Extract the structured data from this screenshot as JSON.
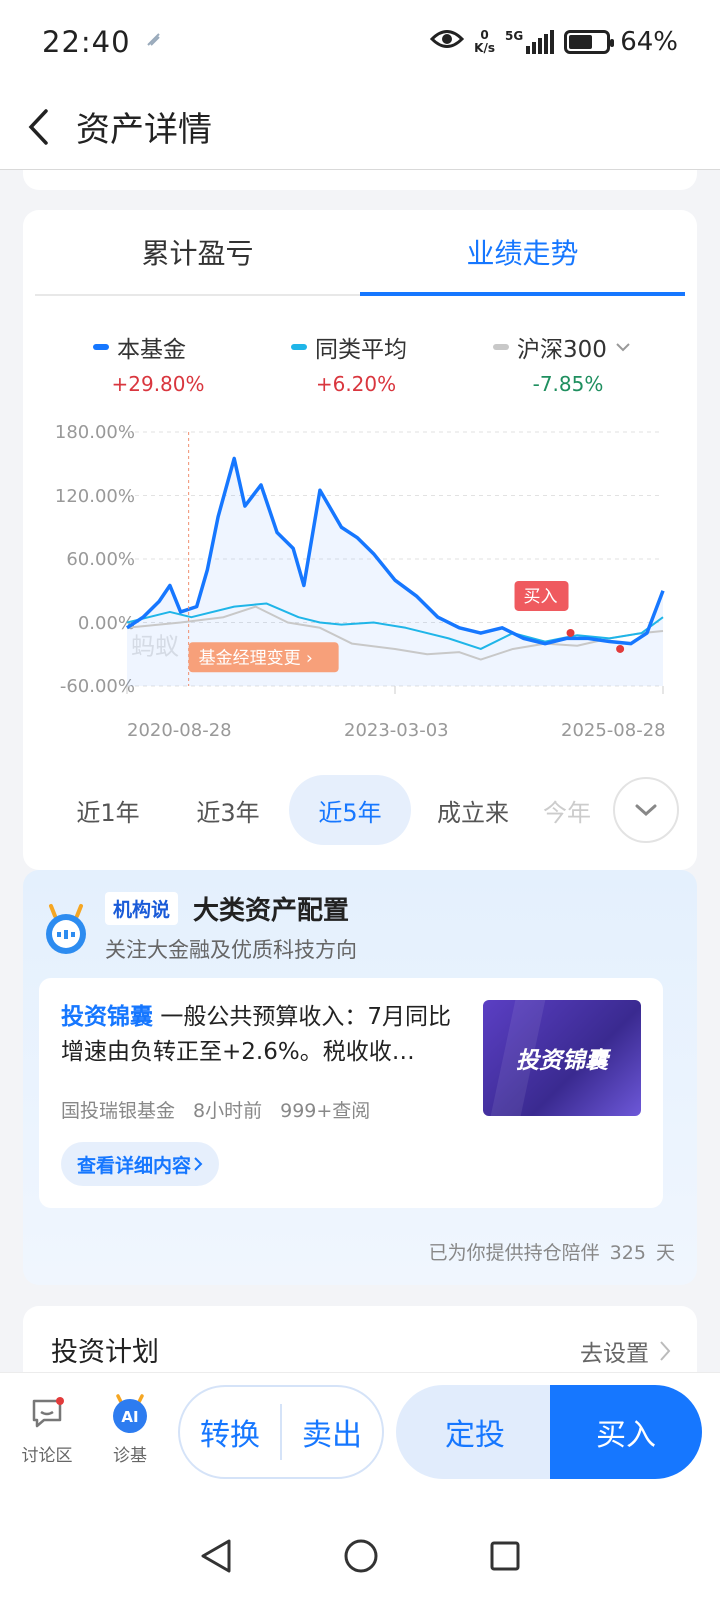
{
  "status": {
    "time": "22:40",
    "net_speed_value": "0",
    "net_speed_unit": "K/s",
    "network": "5G",
    "battery": "64%",
    "battery_level": 0.64
  },
  "header": {
    "title": "资产详情"
  },
  "perf_tabs": [
    {
      "label": "累计盈亏",
      "active": false
    },
    {
      "label": "业绩走势",
      "active": true
    }
  ],
  "legend": [
    {
      "name": "本基金",
      "value": "+29.80%",
      "color": "#1677ff"
    },
    {
      "name": "同类平均",
      "value": "+6.20%",
      "color": "#1fb5e8"
    },
    {
      "name": "沪深300",
      "value": "-7.85%",
      "color": "#c8c8c8"
    }
  ],
  "chart": {
    "watermark": "蚂蚁",
    "manager_change_label": "基金经理变更",
    "buy_marker_label": "买入"
  },
  "chart_data": {
    "type": "line",
    "ylim": [
      -60,
      180
    ],
    "y_ticks": [
      "180.00%",
      "120.00%",
      "60.00%",
      "0.00%",
      "-60.00%"
    ],
    "x_ticks": [
      "2020-08-28",
      "2023-03-03",
      "2025-08-28"
    ],
    "series": [
      {
        "name": "本基金",
        "color": "#1677ff",
        "points": [
          [
            0,
            -5
          ],
          [
            0.03,
            5
          ],
          [
            0.06,
            20
          ],
          [
            0.08,
            35
          ],
          [
            0.1,
            10
          ],
          [
            0.13,
            15
          ],
          [
            0.15,
            50
          ],
          [
            0.17,
            100
          ],
          [
            0.2,
            155
          ],
          [
            0.22,
            110
          ],
          [
            0.25,
            130
          ],
          [
            0.28,
            85
          ],
          [
            0.31,
            70
          ],
          [
            0.33,
            35
          ],
          [
            0.36,
            125
          ],
          [
            0.4,
            90
          ],
          [
            0.43,
            80
          ],
          [
            0.46,
            65
          ],
          [
            0.5,
            40
          ],
          [
            0.54,
            25
          ],
          [
            0.58,
            5
          ],
          [
            0.62,
            -5
          ],
          [
            0.66,
            -10
          ],
          [
            0.7,
            -5
          ],
          [
            0.74,
            -15
          ],
          [
            0.78,
            -20
          ],
          [
            0.82,
            -15
          ],
          [
            0.86,
            -15
          ],
          [
            0.9,
            -18
          ],
          [
            0.94,
            -20
          ],
          [
            0.97,
            -10
          ],
          [
            1.0,
            30
          ]
        ]
      },
      {
        "name": "同类平均",
        "color": "#1fb5e8",
        "points": [
          [
            0,
            0
          ],
          [
            0.08,
            10
          ],
          [
            0.12,
            5
          ],
          [
            0.2,
            15
          ],
          [
            0.26,
            18
          ],
          [
            0.32,
            5
          ],
          [
            0.36,
            0
          ],
          [
            0.4,
            -2
          ],
          [
            0.46,
            0
          ],
          [
            0.52,
            -5
          ],
          [
            0.6,
            -15
          ],
          [
            0.66,
            -25
          ],
          [
            0.72,
            -10
          ],
          [
            0.78,
            -18
          ],
          [
            0.84,
            -12
          ],
          [
            0.9,
            -15
          ],
          [
            0.96,
            -10
          ],
          [
            1.0,
            5
          ]
        ]
      },
      {
        "name": "沪深300",
        "color": "#c8c8c8",
        "points": [
          [
            0,
            -5
          ],
          [
            0.1,
            0
          ],
          [
            0.18,
            5
          ],
          [
            0.24,
            15
          ],
          [
            0.3,
            0
          ],
          [
            0.36,
            -5
          ],
          [
            0.42,
            -20
          ],
          [
            0.5,
            -25
          ],
          [
            0.56,
            -30
          ],
          [
            0.62,
            -28
          ],
          [
            0.66,
            -35
          ],
          [
            0.72,
            -25
          ],
          [
            0.78,
            -20
          ],
          [
            0.84,
            -22
          ],
          [
            0.9,
            -15
          ],
          [
            0.96,
            -10
          ],
          [
            1.0,
            -8
          ]
        ]
      }
    ],
    "manager_change_x": "2020-08-28",
    "buy_marker_x": "2025-01"
  },
  "ranges": [
    {
      "label": "近1年"
    },
    {
      "label": "近3年"
    },
    {
      "label": "近5年",
      "active": true
    },
    {
      "label": "成立来"
    },
    {
      "label": "今年"
    }
  ],
  "institution": {
    "tag": "机构说",
    "title": "大类资产配置",
    "subtitle": "关注大金融及优质科技方向",
    "article": {
      "source": "投资锦囊",
      "text": "一般公共预算收入：7月同比增速由负转正至+2.6%。税收收…",
      "publisher": "国投瑞银基金",
      "time": "8小时前",
      "views": "999+查阅",
      "link": "查看详细内容",
      "thumb_text": "投资锦囊"
    },
    "accompany_prefix": "已为你提供持仓陪伴",
    "accompany_days": "325",
    "accompany_suffix": "天"
  },
  "plan": {
    "title": "投资计划",
    "action": "去设置"
  },
  "bottom": {
    "discuss": "讨论区",
    "diagnose": "诊基",
    "ai_badge": "AI",
    "convert": "转换",
    "sell": "卖出",
    "fixed": "定投",
    "buy": "买入"
  }
}
